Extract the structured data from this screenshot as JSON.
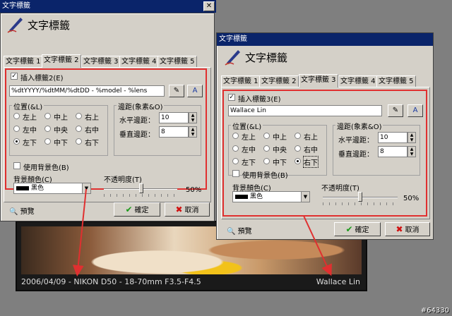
{
  "photo": {
    "caption_left": "2006/04/09 - NIKON D50 - 18-70mm  F3.5-F4.5",
    "caption_right": "Wallace Lin"
  },
  "dialog1": {
    "window_title": "文字標籤",
    "header_title": "文字標籤",
    "tabs": [
      "文字標籤 1",
      "文字標籤 2",
      "文字標籤 3",
      "文字標籤 4",
      "文字標籤 5"
    ],
    "insert_label": "插入標籤2(E)",
    "text_value": "%dtYYYY/%dtMM/%dtDD - %model - %lens",
    "position_label": "位置(&L)",
    "positions": [
      "左上",
      "中上",
      "右上",
      "左中",
      "中央",
      "右中",
      "左下",
      "中下",
      "右下"
    ],
    "margin_label": "邊距(象素&O)",
    "h_margin_label": "水平邊距：",
    "h_margin": "10",
    "v_margin_label": "垂直邊距：",
    "v_margin": "8",
    "use_bg_label": "使用背景色(B)",
    "bg_color_label": "背景顏色(C)",
    "bg_color_value": "黑色",
    "opacity_label": "不透明度(T)",
    "opacity_value": "50%",
    "preview_label": "預覽",
    "ok_label": "確定",
    "cancel_label": "取消"
  },
  "dialog2": {
    "window_title": "文字標籤",
    "header_title": "文字標籤",
    "tabs": [
      "文字標籤 1",
      "文字標籤 2",
      "文字標籤 3",
      "文字標籤 4",
      "文字標籤 5"
    ],
    "insert_label": "插入標籤3(E)",
    "text_value": "Wallace Lin",
    "position_label": "位置(&L)",
    "positions": [
      "左上",
      "中上",
      "右上",
      "左中",
      "中央",
      "右中",
      "左下",
      "中下",
      "右下"
    ],
    "margin_label": "邊距(象素&O)",
    "h_margin_label": "水平邊距：",
    "h_margin": "10",
    "v_margin_label": "垂直邊距：",
    "v_margin": "8",
    "use_bg_label": "使用背景色(B)",
    "bg_color_label": "背景顏色(C)",
    "bg_color_value": "黑色",
    "opacity_label": "不透明度(T)",
    "opacity_value": "50%",
    "preview_label": "預覽",
    "ok_label": "確定",
    "cancel_label": "取消"
  },
  "watermark": "#64330",
  "colors": {
    "title_bar": "#0a246a",
    "highlight": "#e03030",
    "dialog_bg": "#d4d0c8"
  }
}
